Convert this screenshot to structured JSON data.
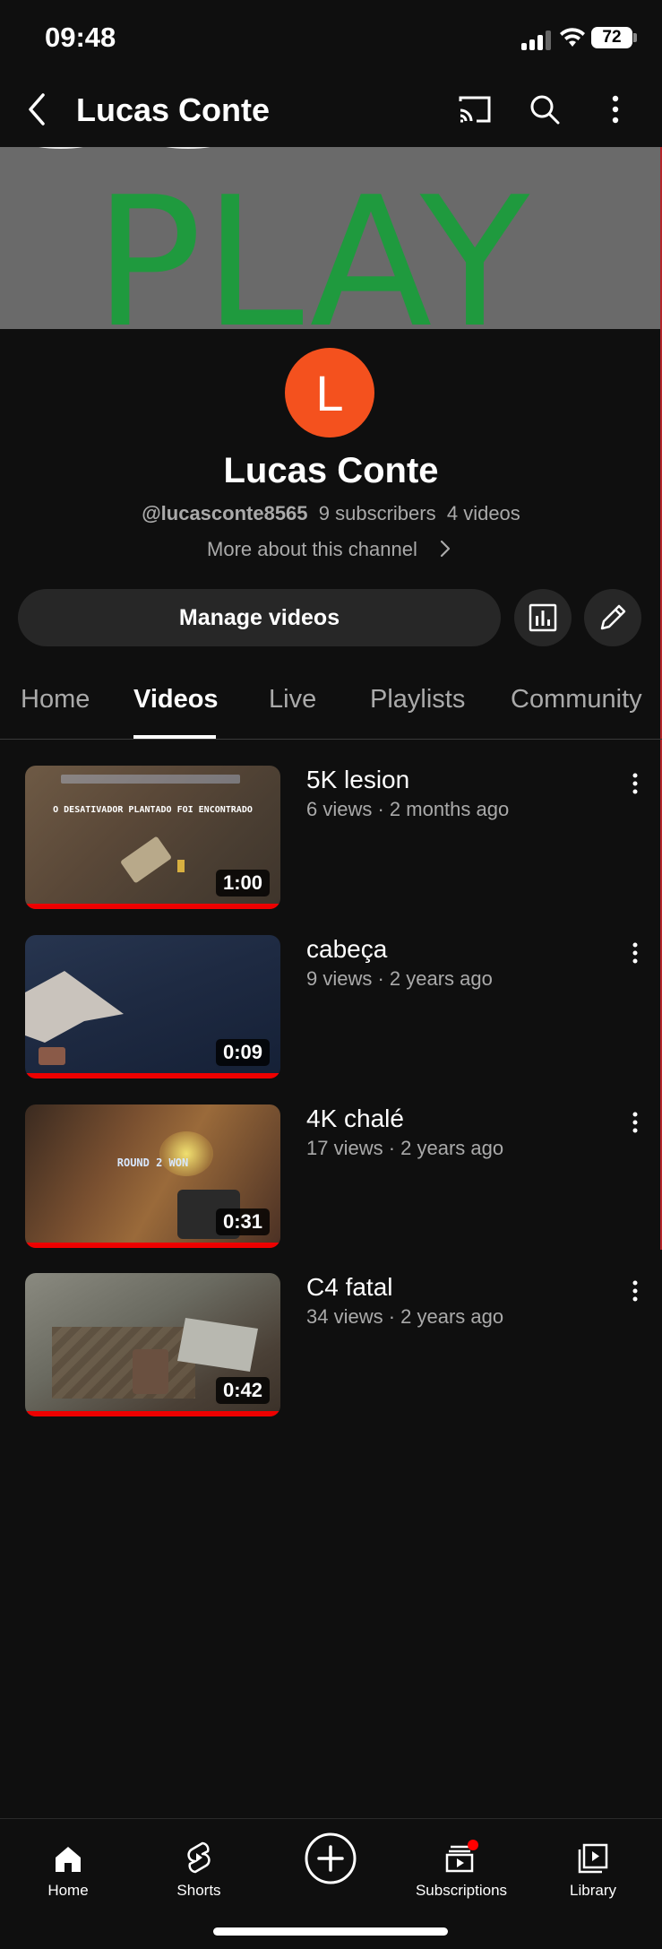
{
  "status_bar": {
    "time": "09:48",
    "battery": "72"
  },
  "app_bar": {
    "title": "Lucas Conte",
    "icons": [
      "back-icon",
      "cast-icon",
      "search-icon",
      "more-vert-icon"
    ]
  },
  "banner": {
    "text": "PLAY",
    "colors": {
      "background": "#6a6a6a",
      "text": "#1f9a3e"
    }
  },
  "channel": {
    "avatar_letter": "L",
    "avatar_color": "#f4511e",
    "name": "Lucas Conte",
    "handle": "@lucasconte8565",
    "subscribers": "9 subscribers",
    "videos_count": "4 videos",
    "more_about": "More about this channel",
    "manage_videos": "Manage videos"
  },
  "tabs": [
    {
      "label": "Home",
      "active": false
    },
    {
      "label": "Videos",
      "active": true
    },
    {
      "label": "Live",
      "active": false
    },
    {
      "label": "Playlists",
      "active": false
    },
    {
      "label": "Community",
      "active": false
    }
  ],
  "videos": [
    {
      "title": "5K lesion",
      "meta": "6 views · 2 months ago",
      "duration": "1:00",
      "thumb_overlay": "O DESATIVADOR PLANTADO FOI ENCONTRADO"
    },
    {
      "title": "cabeça",
      "meta": "9 views · 2 years ago",
      "duration": "0:09"
    },
    {
      "title": "4K chalé",
      "meta": "17 views · 2 years ago",
      "duration": "0:31",
      "thumb_overlay": "ROUND 2 WON"
    },
    {
      "title": "C4 fatal",
      "meta": "34 views · 2 years ago",
      "duration": "0:42"
    }
  ],
  "bottom_nav": [
    {
      "label": "Home",
      "icon": "home-icon"
    },
    {
      "label": "Shorts",
      "icon": "shorts-icon"
    },
    {
      "label": "",
      "icon": "create-icon"
    },
    {
      "label": "Subscriptions",
      "icon": "subscriptions-icon"
    },
    {
      "label": "Library",
      "icon": "library-icon"
    }
  ],
  "colors": {
    "background": "#0f0f0f",
    "accent_red": "#ff0000",
    "muted_text": "#aaaaaa"
  }
}
